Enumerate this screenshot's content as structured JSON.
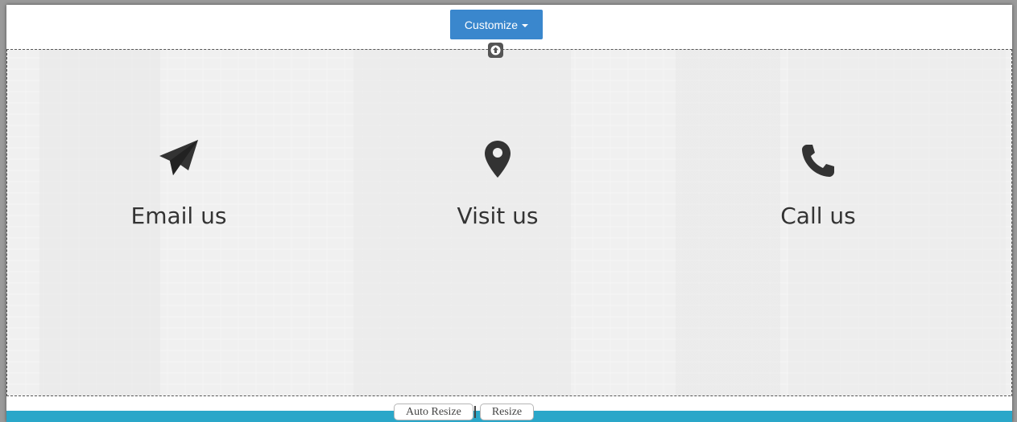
{
  "toolbar": {
    "customize_label": "Customize"
  },
  "contact_items": [
    {
      "label": "Email us",
      "icon": "paper-plane-icon"
    },
    {
      "label": "Visit us",
      "icon": "map-marker-icon"
    },
    {
      "label": "Call us",
      "icon": "phone-icon"
    }
  ],
  "resize_controls": {
    "auto_resize_label": "Auto Resize",
    "resize_label": "Resize"
  },
  "colors": {
    "customize_button": "#3a87cd",
    "bottom_bar": "#2aa7c9",
    "text": "#333333"
  }
}
